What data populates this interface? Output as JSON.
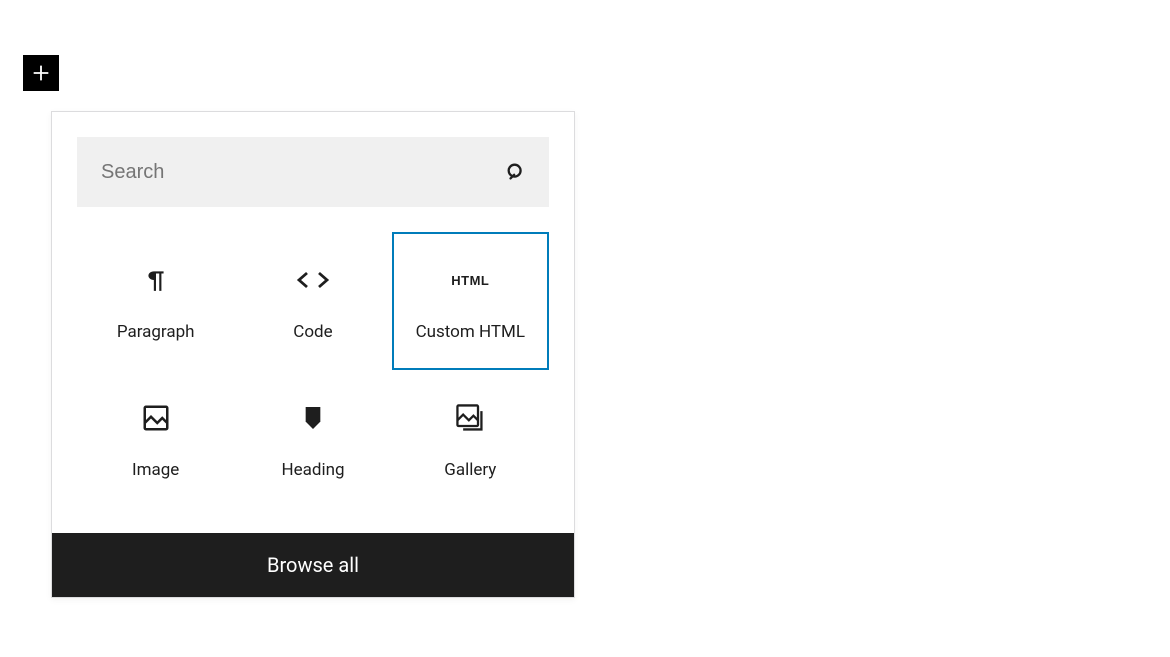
{
  "toggle": {
    "icon": "plus"
  },
  "search": {
    "placeholder": "Search",
    "value": ""
  },
  "blocks": [
    {
      "label": "Paragraph",
      "icon": "paragraph-icon",
      "selected": false
    },
    {
      "label": "Code",
      "icon": "code-icon",
      "selected": false
    },
    {
      "label": "Custom HTML",
      "icon": "html-icon",
      "selected": true
    },
    {
      "label": "Image",
      "icon": "image-icon",
      "selected": false
    },
    {
      "label": "Heading",
      "icon": "heading-icon",
      "selected": false
    },
    {
      "label": "Gallery",
      "icon": "gallery-icon",
      "selected": false
    }
  ],
  "footer": {
    "browse_all": "Browse all"
  },
  "colors": {
    "accent": "#007cba",
    "dark": "#1e1e1e"
  }
}
